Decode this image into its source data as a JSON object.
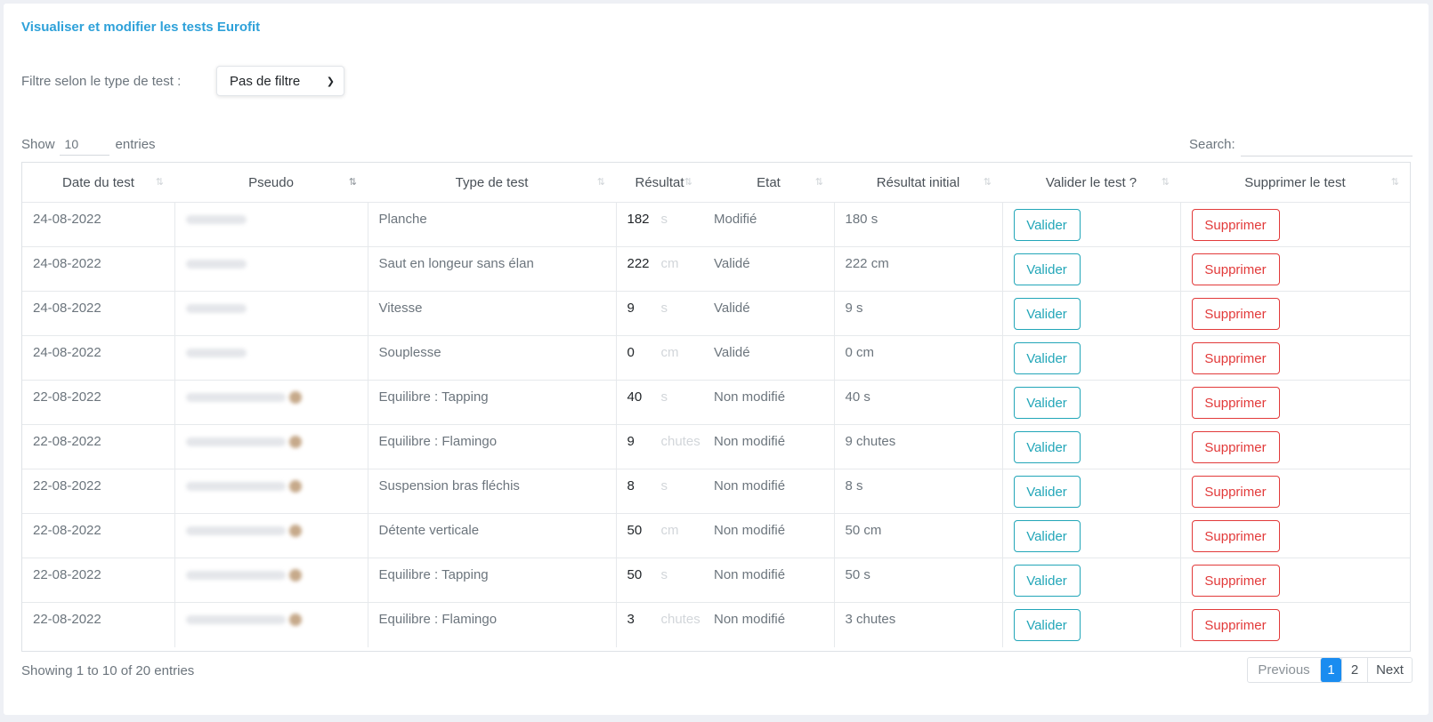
{
  "page": {
    "title": "Visualiser et modifier les tests Eurofit"
  },
  "filter": {
    "label": "Filtre selon le type de test :",
    "selected": "Pas de filtre"
  },
  "length": {
    "show_label": "Show",
    "value": "10",
    "entries_label": "entries"
  },
  "search": {
    "label": "Search:",
    "value": ""
  },
  "table": {
    "columns": [
      "Date du test",
      "Pseudo",
      "Type de test",
      "Résultat",
      "Etat",
      "Résultat initial",
      "Valider le test ?",
      "Supprimer le test"
    ],
    "valider_label": "Valider",
    "supprimer_label": "Supprimer",
    "rows": [
      {
        "date": "24-08-2022",
        "type": "Planche",
        "result": "182",
        "unit": "s",
        "etat": "Modifié",
        "initial": "180 s"
      },
      {
        "date": "24-08-2022",
        "type": "Saut en longeur sans élan",
        "result": "222",
        "unit": "cm",
        "etat": "Validé",
        "initial": "222 cm"
      },
      {
        "date": "24-08-2022",
        "type": "Vitesse",
        "result": "9",
        "unit": "s",
        "etat": "Validé",
        "initial": "9 s"
      },
      {
        "date": "24-08-2022",
        "type": "Souplesse",
        "result": "0",
        "unit": "cm",
        "etat": "Validé",
        "initial": "0 cm"
      },
      {
        "date": "22-08-2022",
        "type": "Equilibre : Tapping",
        "result": "40",
        "unit": "s",
        "etat": "Non modifié",
        "initial": "40 s"
      },
      {
        "date": "22-08-2022",
        "type": "Equilibre : Flamingo",
        "result": "9",
        "unit": "chutes",
        "etat": "Non modifié",
        "initial": "9 chutes"
      },
      {
        "date": "22-08-2022",
        "type": "Suspension bras fléchis",
        "result": "8",
        "unit": "s",
        "etat": "Non modifié",
        "initial": "8 s"
      },
      {
        "date": "22-08-2022",
        "type": "Détente verticale",
        "result": "50",
        "unit": "cm",
        "etat": "Non modifié",
        "initial": "50 cm"
      },
      {
        "date": "22-08-2022",
        "type": "Equilibre : Tapping",
        "result": "50",
        "unit": "s",
        "etat": "Non modifié",
        "initial": "50 s"
      },
      {
        "date": "22-08-2022",
        "type": "Equilibre : Flamingo",
        "result": "3",
        "unit": "chutes",
        "etat": "Non modifié",
        "initial": "3 chutes"
      }
    ]
  },
  "footer": {
    "info": "Showing 1 to 10 of 20 entries",
    "previous": "Previous",
    "pages": [
      "1",
      "2"
    ],
    "next": "Next"
  },
  "colors": {
    "title": "#2ea1d9",
    "valider": "#22a6b8",
    "supprimer": "#e23a3a",
    "active_page": "#1a8cf0"
  },
  "icons": {
    "sort": "sort-icon",
    "select_chevron": "chevron-down-icon"
  }
}
